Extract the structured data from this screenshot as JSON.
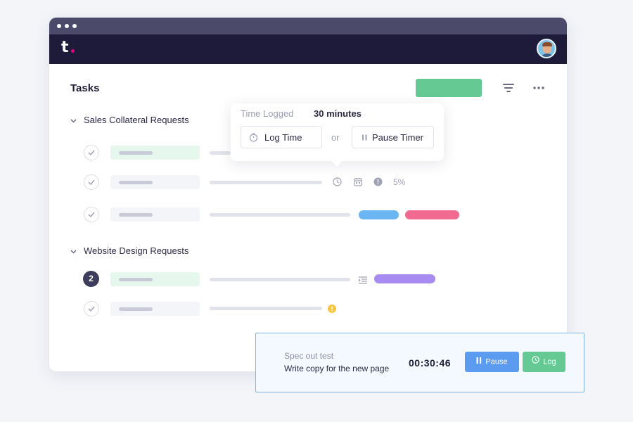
{
  "app": {
    "logo_text": "t",
    "page_title": "Tasks"
  },
  "colors": {
    "accent_green": "#65c993",
    "blue": "#6bb6f2",
    "pink": "#f06b8f",
    "purple": "#a88bf0",
    "warning": "#f5c542"
  },
  "sections": [
    {
      "title": "Sales Collateral Requests",
      "rows": [
        {
          "status": "done",
          "indicator": "none"
        },
        {
          "status": "done",
          "indicator": "time-calendar-progress",
          "progress": "5%"
        },
        {
          "status": "done",
          "indicator": "tags",
          "tags": [
            "blue",
            "pink"
          ]
        }
      ]
    },
    {
      "title": "Website Design Requests",
      "rows": [
        {
          "status": "active",
          "badge_number": "2",
          "indicator": "tags",
          "tags": [
            "purple"
          ]
        },
        {
          "status": "done",
          "indicator": "warning"
        }
      ]
    }
  ],
  "popover": {
    "label": "Time Logged",
    "value": "30 minutes",
    "log_label": "Log Time",
    "or_label": "or",
    "pause_label": "Pause Timer"
  },
  "timer": {
    "title": "Spec out test",
    "subtitle": "Write copy for the new page",
    "elapsed": "00:30:46",
    "pause_label": "Pause",
    "log_label": "Log"
  },
  "icons": {
    "filter": "filter-lines-icon",
    "more": "more-horizontal-icon",
    "check": "check-icon",
    "clock": "clock-icon",
    "calendar": "calendar-icon",
    "alert": "alert-circle-icon",
    "list": "list-icon",
    "pause": "pause-icon"
  }
}
